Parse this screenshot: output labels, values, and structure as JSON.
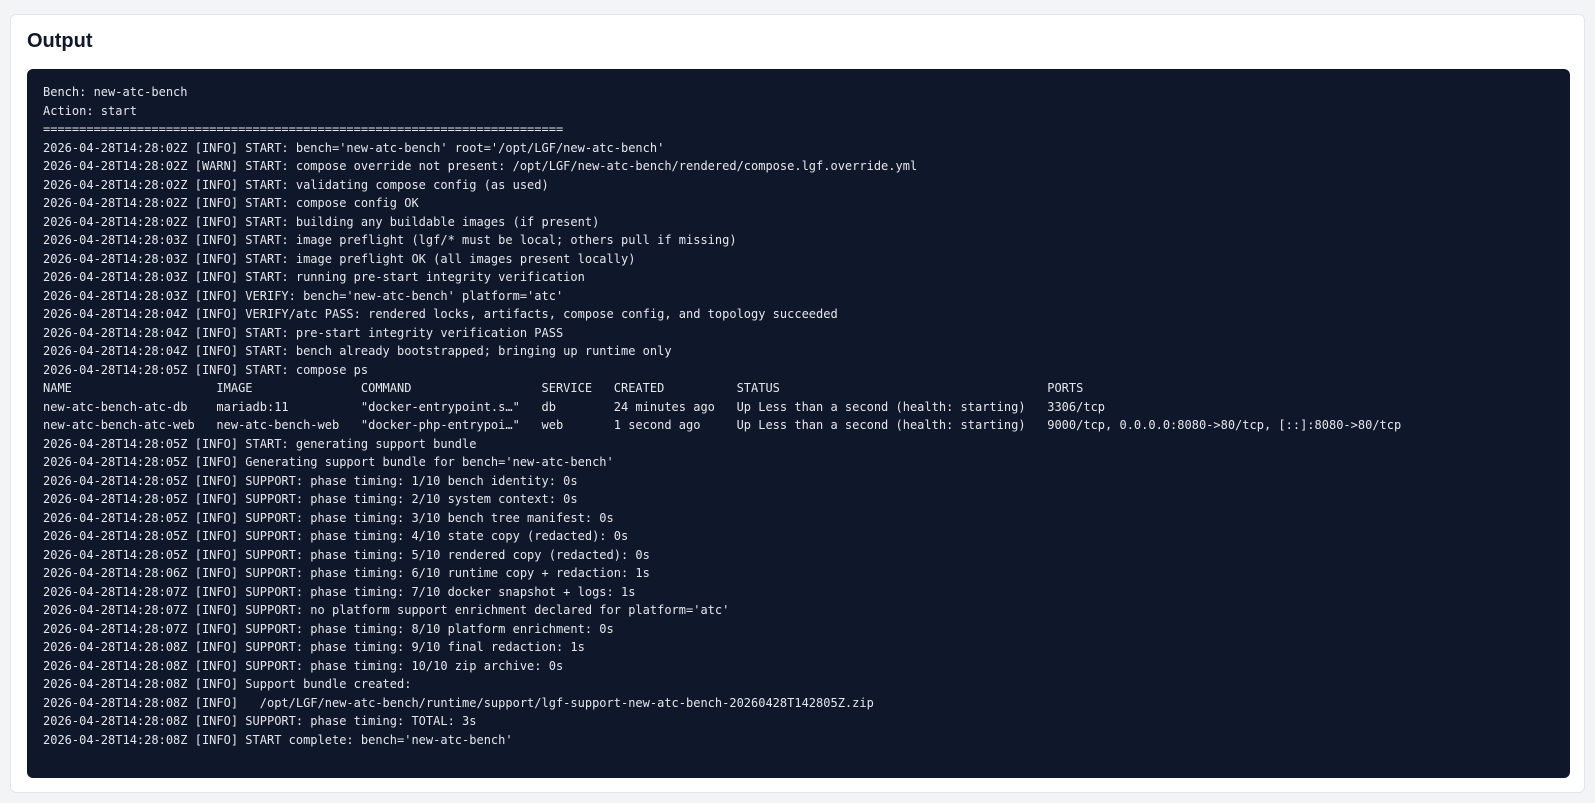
{
  "panel": {
    "title": "Output"
  },
  "log": {
    "lines": [
      "Bench: new-atc-bench",
      "Action: start",
      "========================================================================",
      "2026-04-28T14:28:02Z [INFO] START: bench='new-atc-bench' root='/opt/LGF/new-atc-bench'",
      "2026-04-28T14:28:02Z [WARN] START: compose override not present: /opt/LGF/new-atc-bench/rendered/compose.lgf.override.yml",
      "2026-04-28T14:28:02Z [INFO] START: validating compose config (as used)",
      "2026-04-28T14:28:02Z [INFO] START: compose config OK",
      "2026-04-28T14:28:02Z [INFO] START: building any buildable images (if present)",
      "2026-04-28T14:28:03Z [INFO] START: image preflight (lgf/* must be local; others pull if missing)",
      "2026-04-28T14:28:03Z [INFO] START: image preflight OK (all images present locally)",
      "2026-04-28T14:28:03Z [INFO] START: running pre-start integrity verification",
      "2026-04-28T14:28:03Z [INFO] VERIFY: bench='new-atc-bench' platform='atc'",
      "2026-04-28T14:28:04Z [INFO] VERIFY/atc PASS: rendered locks, artifacts, compose config, and topology succeeded",
      "2026-04-28T14:28:04Z [INFO] START: pre-start integrity verification PASS",
      "2026-04-28T14:28:04Z [INFO] START: bench already bootstrapped; bringing up runtime only",
      "2026-04-28T14:28:05Z [INFO] START: compose ps",
      "NAME                    IMAGE               COMMAND                  SERVICE   CREATED          STATUS                                     PORTS",
      "new-atc-bench-atc-db    mariadb:11          \"docker-entrypoint.s…\"   db        24 minutes ago   Up Less than a second (health: starting)   3306/tcp",
      "new-atc-bench-atc-web   new-atc-bench-web   \"docker-php-entrypoi…\"   web       1 second ago     Up Less than a second (health: starting)   9000/tcp, 0.0.0.0:8080->80/tcp, [::]:8080->80/tcp",
      "2026-04-28T14:28:05Z [INFO] START: generating support bundle",
      "2026-04-28T14:28:05Z [INFO] Generating support bundle for bench='new-atc-bench'",
      "2026-04-28T14:28:05Z [INFO] SUPPORT: phase timing: 1/10 bench identity: 0s",
      "2026-04-28T14:28:05Z [INFO] SUPPORT: phase timing: 2/10 system context: 0s",
      "2026-04-28T14:28:05Z [INFO] SUPPORT: phase timing: 3/10 bench tree manifest: 0s",
      "2026-04-28T14:28:05Z [INFO] SUPPORT: phase timing: 4/10 state copy (redacted): 0s",
      "2026-04-28T14:28:05Z [INFO] SUPPORT: phase timing: 5/10 rendered copy (redacted): 0s",
      "2026-04-28T14:28:06Z [INFO] SUPPORT: phase timing: 6/10 runtime copy + redaction: 1s",
      "2026-04-28T14:28:07Z [INFO] SUPPORT: phase timing: 7/10 docker snapshot + logs: 1s",
      "2026-04-28T14:28:07Z [INFO] SUPPORT: no platform support enrichment declared for platform='atc'",
      "2026-04-28T14:28:07Z [INFO] SUPPORT: phase timing: 8/10 platform enrichment: 0s",
      "2026-04-28T14:28:08Z [INFO] SUPPORT: phase timing: 9/10 final redaction: 1s",
      "2026-04-28T14:28:08Z [INFO] SUPPORT: phase timing: 10/10 zip archive: 0s",
      "2026-04-28T14:28:08Z [INFO] Support bundle created:",
      "2026-04-28T14:28:08Z [INFO]   /opt/LGF/new-atc-bench/runtime/support/lgf-support-new-atc-bench-20260428T142805Z.zip",
      "2026-04-28T14:28:08Z [INFO] SUPPORT: phase timing: TOTAL: 3s",
      "2026-04-28T14:28:08Z [INFO] START complete: bench='new-atc-bench'"
    ]
  }
}
